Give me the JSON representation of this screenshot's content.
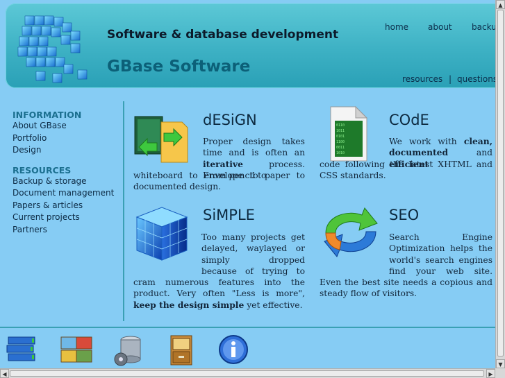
{
  "header": {
    "tagline": "Software & database development",
    "brand": "GBase Software",
    "nav": [
      "home",
      "about",
      "backup"
    ],
    "subnav": [
      "resources",
      "|",
      "questions"
    ]
  },
  "sidebar": {
    "information_heading": "INFORMATION",
    "information_items": [
      "About GBase",
      "Portfolio",
      "Design"
    ],
    "resources_heading": "RESOURCES",
    "resources_items": [
      "Backup & storage",
      "Document management",
      "Papers & articles",
      "Current projects",
      "Partners"
    ]
  },
  "features": {
    "design": {
      "title": "dESiGN",
      "lines": [
        "Proper design takes time",
        "and is often an",
        "iterative",
        "process. From pencil to",
        "whiteboard to envelope to paper to documented design."
      ]
    },
    "code": {
      "title": "COdE",
      "t1": "We work with",
      "b1": "clean,",
      "b2": "documented",
      "t2": "and",
      "b3": "efficient",
      "t3": "code following the latest XHTML and CSS standards."
    },
    "simple": {
      "title": "SiMPLE",
      "t1": "Too many projects get delayed, waylayed or simply dropped because of trying to cram numerous features into the product. Very often \"Less is more\",",
      "b1": "keep the design simple",
      "t2": "yet effective."
    },
    "seo": {
      "title": "SEO",
      "t1": "Search Engine Optimization helps the world's search engines find your web site. Even the best site needs a copious and steady flow of visitors."
    }
  },
  "colors": {
    "page_bg": "#86ccf4",
    "header_bg": "#3db1c4",
    "accent": "#1b6f8f"
  },
  "icons": [
    "database-icon",
    "photos-icon",
    "storage-gear-icon",
    "file-cabinet-icon",
    "info-icon"
  ]
}
